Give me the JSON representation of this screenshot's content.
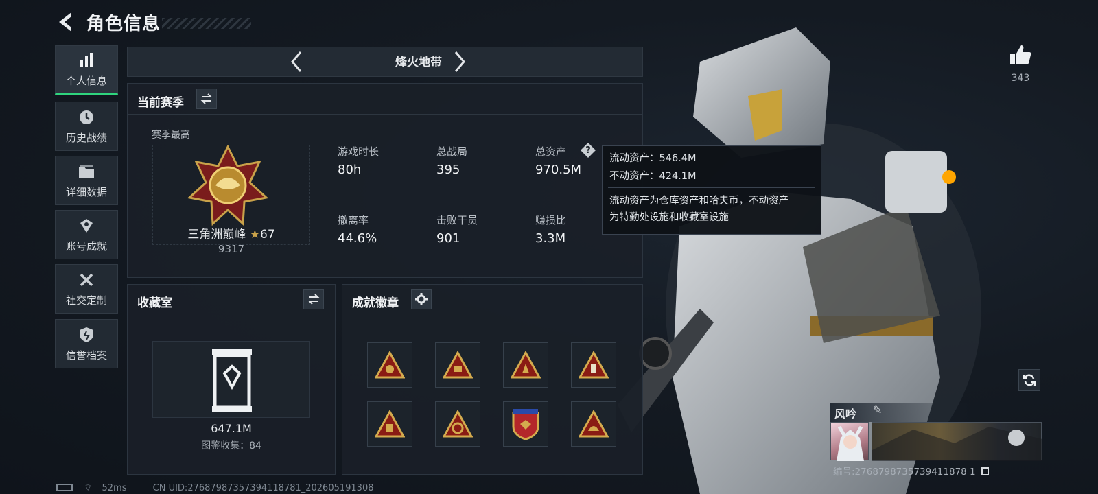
{
  "header": {
    "title": "角色信息"
  },
  "nav": [
    {
      "label": "个人信息",
      "icon": "bar-chart-icon",
      "active": true
    },
    {
      "label": "历史战绩",
      "icon": "clock-icon",
      "active": false
    },
    {
      "label": "详细数据",
      "icon": "folder-icon",
      "active": false
    },
    {
      "label": "账号成就",
      "icon": "achievement-icon",
      "active": false
    },
    {
      "label": "社交定制",
      "icon": "tools-icon",
      "active": false
    },
    {
      "label": "信誉档案",
      "icon": "shield-icon",
      "active": false
    }
  ],
  "mode": {
    "title": "烽火地带"
  },
  "season": {
    "title": "当前赛季",
    "best_label": "赛季最高",
    "rank_name": "三角洲巅峰",
    "rank_stars": "67",
    "rank_score": "9317",
    "stats": [
      {
        "label": "游戏时长",
        "value": "80h"
      },
      {
        "label": "总战局",
        "value": "395"
      },
      {
        "label": "总资产",
        "value": "970.5M"
      },
      {
        "label": "撤离率",
        "value": "44.6%"
      },
      {
        "label": "击败干员",
        "value": "901"
      },
      {
        "label": "赚损比",
        "value": "3.3M"
      }
    ]
  },
  "tooltip": {
    "liquid": "流动资产：546.4M",
    "fixed": "不动资产：424.1M",
    "desc_line1": "流动资产为仓库资产和哈夫币，不动资产",
    "desc_line2": "为特勤处设施和收藏室设施"
  },
  "collection": {
    "title": "收藏室",
    "value": "647.1M",
    "count": "图鉴收集：84"
  },
  "badges": {
    "title": "成就徽章",
    "items": [
      "badge-1",
      "badge-2",
      "badge-3",
      "badge-4",
      "badge-5",
      "badge-6",
      "badge-7",
      "badge-8"
    ]
  },
  "likes": {
    "count": "343"
  },
  "player": {
    "name": "风吟",
    "id": "编号:2768798735739411878 1"
  },
  "status": {
    "ping": "52ms",
    "uid": "CN UID:27687987357394118781_202605191308"
  },
  "colors": {
    "accent_green": "#2fd57e",
    "gold": "#c9a24a",
    "panel": "#1a2028"
  }
}
